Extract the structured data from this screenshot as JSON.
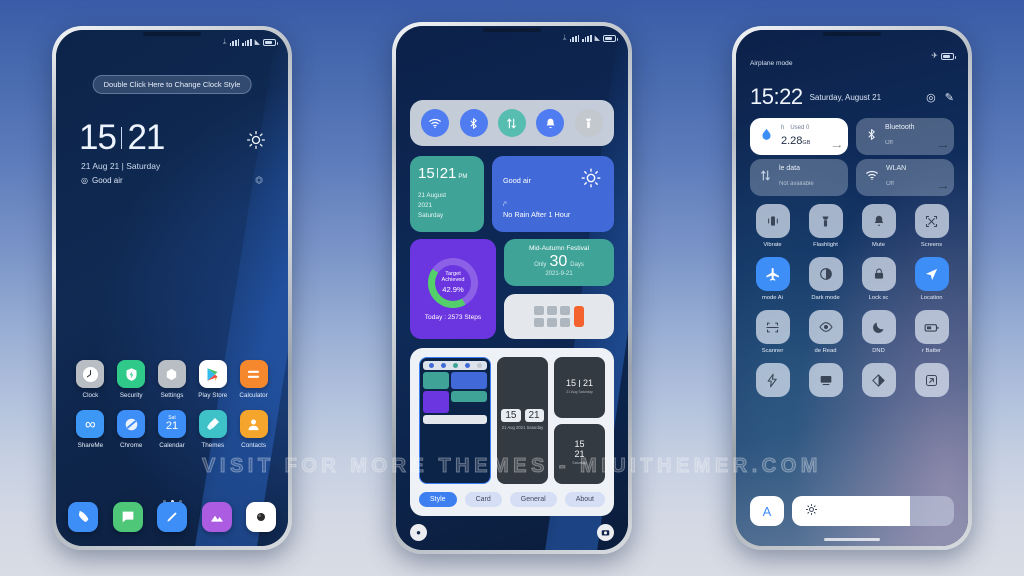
{
  "watermark": "VISIT FOR MORE THEMES - MIUITHEMER.COM",
  "background": {
    "top_color": "#3a5ca8",
    "bottom_color": "#d9dce4"
  },
  "phone1": {
    "statusbar": {
      "bluetooth": "bluetooth-icon",
      "signal1": "signal-icon",
      "signal2": "signal-icon",
      "wifi": "wifi-icon",
      "battery": "battery-icon"
    },
    "clock_style_hint": "Double Click Here to Change Clock Style",
    "time": {
      "hour": "15",
      "minute": "21"
    },
    "date": "21 Aug 21 | Saturday",
    "air_quality": "Good air",
    "weather_icon": "sun-icon",
    "refresh_icon": "refresh-icon",
    "apps": [
      {
        "label": "Clock",
        "icon": "clock-icon",
        "glyph": "◔",
        "bg": "#b9bec4",
        "fg": "#ffffff"
      },
      {
        "label": "Security",
        "icon": "shield-icon",
        "glyph": "⚡",
        "bg": "#2fc98a",
        "fg": "#ffffff"
      },
      {
        "label": "Settings",
        "icon": "gear-icon",
        "glyph": "⬢",
        "bg": "#b9bec4",
        "fg": "#ffffff"
      },
      {
        "label": "Play Store",
        "icon": "play-store-icon",
        "glyph": "▶",
        "bg": "#ffffff",
        "fg": "#2fa8e0"
      },
      {
        "label": "Calculator",
        "icon": "calculator-icon",
        "glyph": "≡",
        "bg": "#f5872c",
        "fg": "#ffffff"
      },
      {
        "label": "ShareMe",
        "icon": "shareme-icon",
        "glyph": "∞",
        "bg": "#3d97f5",
        "fg": "#ffffff"
      },
      {
        "label": "Chrome",
        "icon": "chrome-icon",
        "glyph": "●",
        "bg": "#3d8ef7",
        "fg": "#ffffff"
      },
      {
        "label": "Calendar",
        "icon": "calendar-icon",
        "glyph": "21",
        "bg": "#3d8ef7",
        "fg": "#ffffff"
      },
      {
        "label": "Themes",
        "icon": "themes-icon",
        "glyph": "◆",
        "bg": "#3ec2c8",
        "fg": "#ffffff"
      },
      {
        "label": "Contacts",
        "icon": "contacts-icon",
        "glyph": "●",
        "bg": "#f5a52c",
        "fg": "#ffffff"
      }
    ],
    "calendar_day_label": "Sat",
    "calendar_day_number": "21",
    "page_dots": 3,
    "page_active": 1,
    "dock": [
      {
        "label": "Phone",
        "icon": "phone-icon",
        "glyph": "✆",
        "bg": "#3d8ef7"
      },
      {
        "label": "Messages",
        "icon": "message-icon",
        "glyph": "◨",
        "bg": "#4ec878"
      },
      {
        "label": "Notes",
        "icon": "pencil-icon",
        "glyph": "╱",
        "bg": "#3d8ef7"
      },
      {
        "label": "Gallery",
        "icon": "gallery-icon",
        "glyph": "▲",
        "bg": "#ab5ce0"
      },
      {
        "label": "Camera",
        "icon": "camera-icon",
        "glyph": "◉",
        "bg": "#ffffff"
      }
    ]
  },
  "phone2": {
    "statusbar": {
      "bluetooth": "bluetooth-icon",
      "signal1": "signal-icon",
      "signal2": "signal-icon",
      "wifi": "wifi-icon",
      "battery": "battery-icon"
    },
    "toggles": [
      {
        "name": "wifi-toggle",
        "icon": "wifi-icon",
        "glyph": "◔",
        "bg": "#4f7cf0",
        "state": "on"
      },
      {
        "name": "bluetooth-toggle",
        "icon": "bluetooth-icon",
        "glyph": "ᛦ",
        "bg": "#4f7cf0",
        "state": "on"
      },
      {
        "name": "mobile-data-toggle",
        "icon": "data-icon",
        "glyph": "⇅",
        "bg": "#57bdb0",
        "state": "on"
      },
      {
        "name": "ring-toggle",
        "icon": "bell-icon",
        "glyph": "ὑ4",
        "bg": "#4f7cf0",
        "state": "on"
      },
      {
        "name": "flashlight-toggle",
        "icon": "flashlight-icon",
        "glyph": "▼",
        "bg": "#c3c8cf",
        "state": "off"
      }
    ],
    "clock_widget": {
      "hour": "15",
      "minute": "21",
      "meridiem": "PM",
      "day": "21 August",
      "year": "2021",
      "weekday": "Saturday"
    },
    "weather_widget": {
      "air": "Good air",
      "temp": "/°",
      "rain": "No Rain After 1 Hour",
      "icon": "sun-icon"
    },
    "steps_widget": {
      "target_line1": "Target",
      "target_line2": "Achieved",
      "percent": "42.9%",
      "today": "Today : 2573 Steps",
      "progress": 42.9
    },
    "festival_widget": {
      "title": "Mid-Autumn Festival",
      "prefix": "Only",
      "number": "30",
      "suffix": "Days",
      "date": "2021-9-21"
    },
    "calculator_widget": {
      "icon": "calculator-icon"
    },
    "editor": {
      "preview_label": "theme-preview",
      "flip_clock": {
        "hour": "15",
        "minute": "21",
        "sub": "21 Aug 2021\nSaturday"
      },
      "card_inline": {
        "hour": "15",
        "minute": "21",
        "sub": "21 Aug Saturday"
      },
      "card_stack": {
        "hour": "15",
        "minute": "21",
        "sub": "Saturday"
      },
      "tabs": [
        {
          "label": "Style",
          "active": true
        },
        {
          "label": "Card",
          "active": false
        },
        {
          "label": "General",
          "active": false
        },
        {
          "label": "About",
          "active": false
        }
      ]
    },
    "shortcut_left": {
      "icon": "flashlight-icon",
      "glyph": "●"
    },
    "shortcut_right": {
      "icon": "camera-icon",
      "glyph": "■"
    }
  },
  "phone3": {
    "airplane_label": "Airplane mode",
    "airplane_icon": "airplane-icon",
    "battery_icon": "battery-icon",
    "time": "15:22",
    "date": "Saturday, August 21",
    "header_icons": [
      {
        "name": "settings-icon",
        "glyph": "◎"
      },
      {
        "name": "edit-icon",
        "glyph": "✎"
      }
    ],
    "big_tiles": [
      {
        "name": "data-usage-tile",
        "icon": "water-drop-icon",
        "glyph": "◆",
        "usage_prefix": "h",
        "usage_label": "Used 0",
        "amount": "2.28",
        "unit": "GB",
        "state": "on"
      },
      {
        "name": "bluetooth-tile",
        "icon": "bluetooth-icon",
        "glyph": "ᛦ",
        "title": "Bluetooth",
        "sub": "Off",
        "state": "off"
      },
      {
        "name": "mobile-data-tile",
        "icon": "data-icon",
        "glyph": "⇅",
        "title": "le data",
        "sub": "Not available",
        "state": "off"
      },
      {
        "name": "wlan-tile",
        "icon": "wifi-icon",
        "glyph": "◔",
        "title": "WLAN",
        "sub": "Off",
        "state": "off"
      }
    ],
    "tiles": [
      {
        "label": "Vibrate",
        "icon": "vibrate-icon",
        "glyph": "▒",
        "active": false
      },
      {
        "label": "Flashlight",
        "icon": "flashlight-icon",
        "glyph": "▼",
        "active": false
      },
      {
        "label": "Mute",
        "icon": "bell-icon",
        "glyph": "ὑ4",
        "active": false
      },
      {
        "label": "Screens",
        "icon": "screenshot-icon",
        "glyph": "✂",
        "active": false
      },
      {
        "label": "mode   Ai",
        "icon": "airplane-icon",
        "glyph": "✈",
        "active": true
      },
      {
        "label": "Dark mode",
        "icon": "dark-mode-icon",
        "glyph": "◑",
        "active": false
      },
      {
        "label": "Lock sc",
        "icon": "lock-icon",
        "glyph": "ὑ2",
        "active": false
      },
      {
        "label": "Location",
        "icon": "location-icon",
        "glyph": "➤",
        "active": true
      },
      {
        "label": "Scanner",
        "icon": "scanner-icon",
        "glyph": "⬚",
        "active": false
      },
      {
        "label": "de   Read",
        "icon": "reading-mode-icon",
        "glyph": "◉",
        "active": false
      },
      {
        "label": "DND",
        "icon": "moon-icon",
        "glyph": "☽",
        "active": false
      },
      {
        "label": "r   Batter",
        "icon": "battery-icon",
        "glyph": "▭",
        "active": false
      },
      {
        "label": "",
        "icon": "power-icon",
        "glyph": "⚡",
        "active": false
      },
      {
        "label": "",
        "icon": "cast-icon",
        "glyph": "▭",
        "active": false
      },
      {
        "label": "",
        "icon": "contrast-icon",
        "glyph": "◗",
        "active": false
      },
      {
        "label": "",
        "icon": "expand-icon",
        "glyph": "⤡",
        "active": false
      }
    ],
    "auto_brightness": {
      "name": "auto-brightness-toggle",
      "label": "A"
    },
    "brightness": {
      "name": "brightness-slider",
      "icon": "sun-icon",
      "value": 73
    }
  }
}
